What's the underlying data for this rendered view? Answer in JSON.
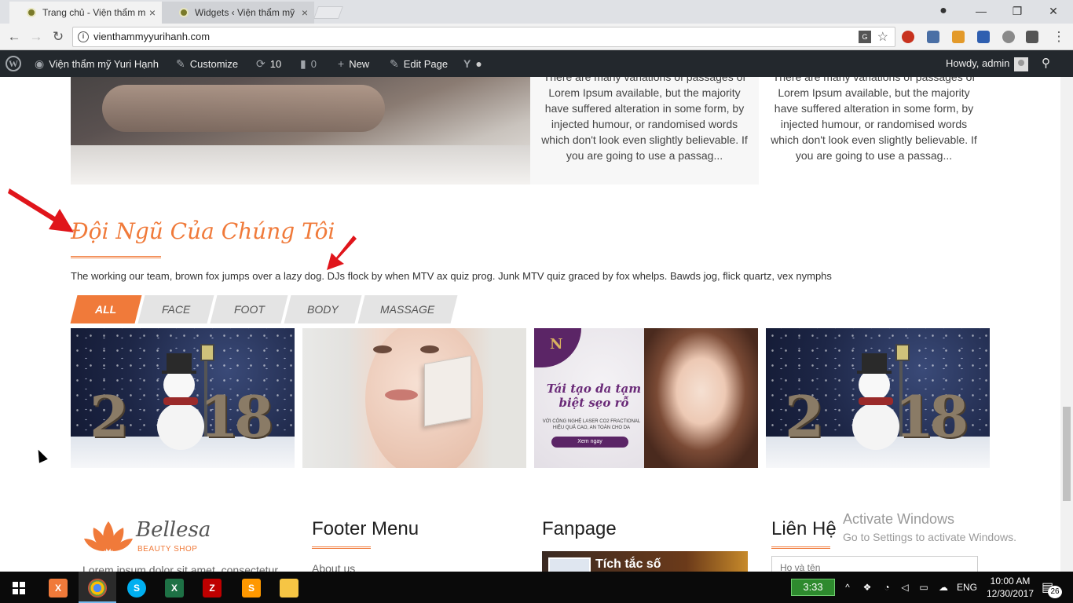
{
  "browser": {
    "tabs": [
      {
        "label": "Trang chủ - Viện thẩm m",
        "active": true
      },
      {
        "label": "Widgets ‹ Viện thẩm mỹ",
        "active": false
      }
    ],
    "url": "vienthammyyurihanh.com",
    "window_controls": {
      "minimize": "—",
      "restore": "❐",
      "close": "✕"
    }
  },
  "admin_bar": {
    "site_name": "Viện thẩm mỹ Yuri Hạnh",
    "customize": "Customize",
    "updates_count": "10",
    "comments_count": "0",
    "new": "New",
    "edit_page": "Edit Page",
    "howdy": "Howdy, admin"
  },
  "posts": [
    {
      "text": "There are many variations of passages of Lorem Ipsum available, but the majority have suffered alteration in some form, by injected humour, or randomised words which don't look even slightly believable. If you are going to use a passag..."
    },
    {
      "text": "There are many variations of passages of Lorem Ipsum available, but the majority have suffered alteration in some form, by injected humour, or randomised words which don't look even slightly believable. If you are going to use a passag..."
    }
  ],
  "team_section": {
    "title": "Đội Ngũ Của Chúng Tôi",
    "description": "The working our team, brown fox jumps over a lazy dog. DJs flock by when MTV ax quiz prog. Junk MTV quiz graced by fox whelps. Bawds jog, flick quartz, vex nymphs",
    "filters": [
      "ALL",
      "FACE",
      "FOOT",
      "BODY",
      "MASSAGE"
    ],
    "active_filter": "ALL",
    "gallery": [
      {
        "image": "snowman-2018",
        "year_left": "2",
        "year_right": "18"
      },
      {
        "image": "skin-peel-face"
      },
      {
        "image": "laser-promo",
        "headline": "Tái tạo da tạm biệt sẹo rỗ",
        "sub": "VỚI CÔNG NGHỆ LASER CO2 FRACTIONAL HIỆU QUẢ CAO, AN TOÀN CHO DA",
        "cta": "Xem ngay"
      },
      {
        "image": "snowman-2018",
        "year_left": "2",
        "year_right": "18"
      }
    ]
  },
  "footer": {
    "logo_text": "Bellesa",
    "logo_sub": "BEAUTY SHOP",
    "intro": "Lorem ipsum dolor sit amet, consectetur",
    "menu_heading": "Footer Menu",
    "menu_first": "About us",
    "fanpage_heading": "Fanpage",
    "fanpage_name": "Tích tắc số",
    "contact_heading": "Liên Hệ",
    "contact_placeholder": "Họ và tên"
  },
  "watermark": {
    "line1": "Activate Windows",
    "line2": "Go to Settings to activate Windows."
  },
  "taskbar": {
    "battery_time": "3:33",
    "language": "ENG",
    "time": "10:00 AM",
    "date": "12/30/2017",
    "notifications": "26"
  },
  "colors": {
    "accent": "#f07a3a",
    "adminbar": "#23282d",
    "arrow": "#e0151b"
  }
}
